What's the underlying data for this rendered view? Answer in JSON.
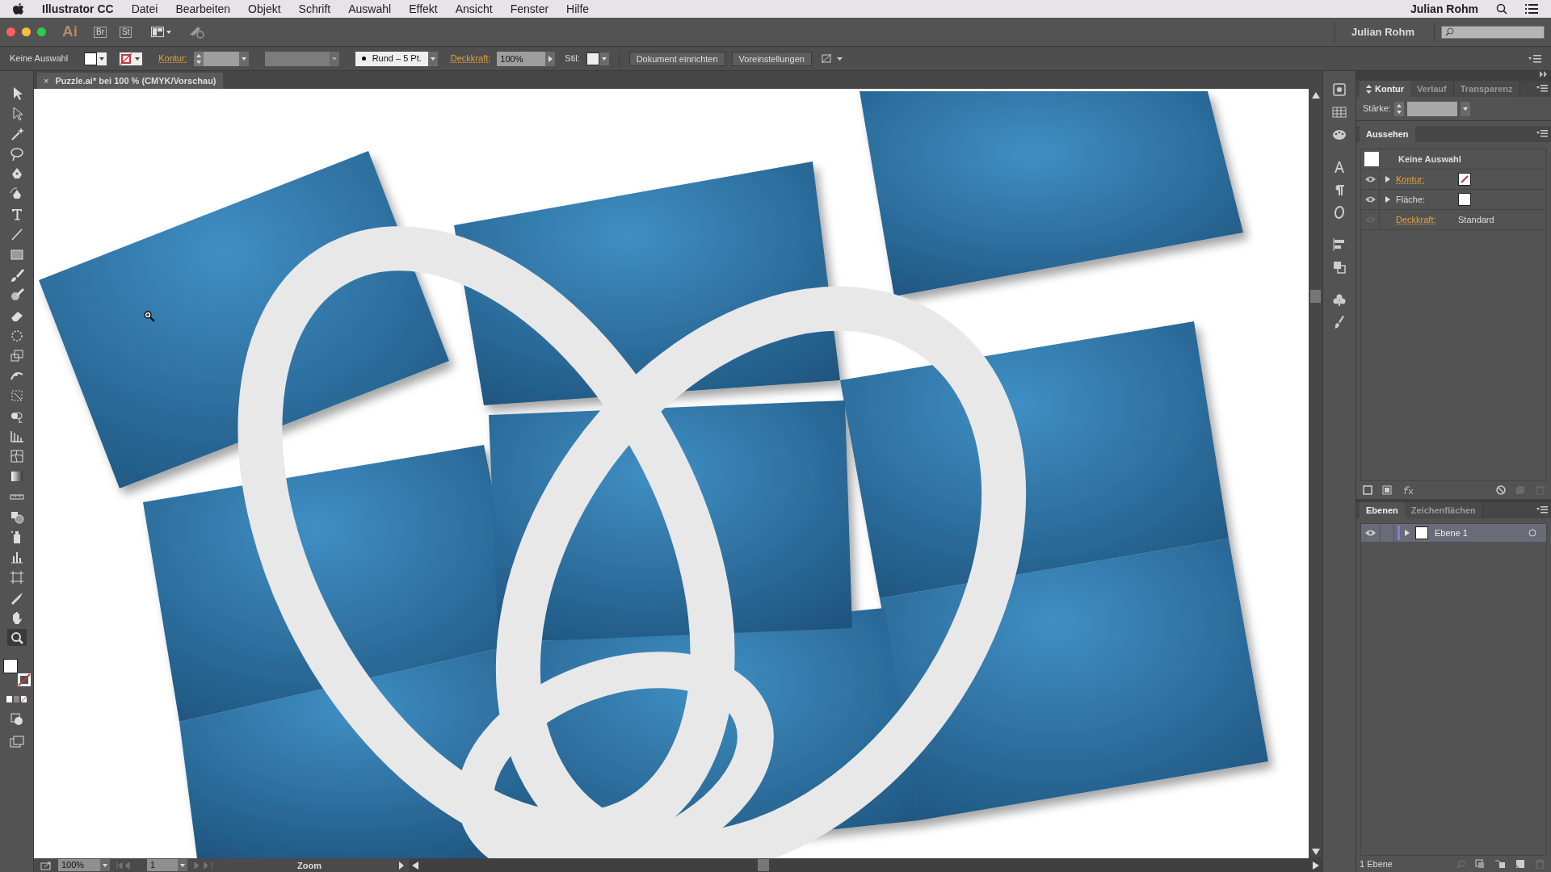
{
  "menu_bar": {
    "app_name": "Illustrator CC",
    "items": [
      "Datei",
      "Bearbeiten",
      "Objekt",
      "Schrift",
      "Auswahl",
      "Effekt",
      "Ansicht",
      "Fenster",
      "Hilfe"
    ],
    "user": "Julian Rohm"
  },
  "app_bar": {
    "logo": "Ai",
    "bridge": "Br",
    "stock": "St",
    "user": "Julian Rohm"
  },
  "control_bar": {
    "selection": "Keine Auswahl",
    "stroke_label": "Kontur:",
    "brush": "Rund – 5 Pt.",
    "opacity_label": "Deckkraft:",
    "opacity": "100%",
    "style_label": "Stil:",
    "buttons": [
      "Dokument einrichten",
      "Voreinstellungen"
    ]
  },
  "document_tab": {
    "close": "×",
    "title": "Puzzle.ai* bei 100 % (CMYK/Vorschau)"
  },
  "stroke_panel": {
    "tabs": [
      {
        "label": "Kontur",
        "selected": true
      },
      {
        "label": "Verlauf",
        "selected": false
      },
      {
        "label": "Transparenz",
        "selected": false
      }
    ],
    "weight_label": "Stärke:"
  },
  "appearance_panel": {
    "title": "Aussehen",
    "header": "Keine Auswahl",
    "rows": [
      {
        "kind": "stroke",
        "label": "Kontur:",
        "linked": true,
        "visible": true
      },
      {
        "kind": "fill",
        "label": "Fläche:",
        "linked": false,
        "visible": true
      },
      {
        "kind": "opacity",
        "label": "Deckkraft:",
        "linked": true,
        "visible": false,
        "value": "Standard"
      }
    ]
  },
  "layers_panel": {
    "tabs": [
      {
        "label": "Ebenen",
        "selected": true
      },
      {
        "label": "Zeichenflächen",
        "selected": false
      }
    ],
    "layers": [
      {
        "name": "Ebene 1",
        "expanded": false
      }
    ],
    "footer": "1 Ebene"
  },
  "status_bar": {
    "zoom": "100%",
    "artboard": "1",
    "tool": "Zoom"
  }
}
